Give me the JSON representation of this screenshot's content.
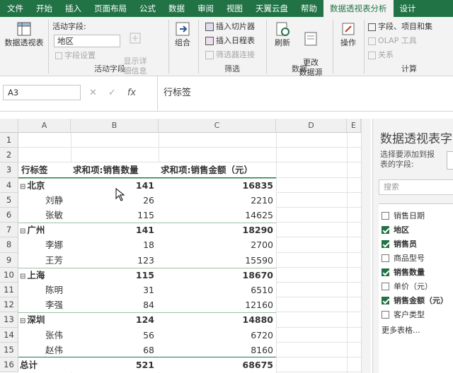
{
  "tabs": [
    "文件",
    "开始",
    "插入",
    "页面布局",
    "公式",
    "数据",
    "审阅",
    "视图",
    "天翼云盘",
    "帮助",
    "数据透视表分析",
    "设计"
  ],
  "active_tab_index": 10,
  "ribbon": {
    "pivot_button": "数据透视表",
    "active_field_label": "活动字段:",
    "active_field_value": "地区",
    "field_settings": "字段设置",
    "show_details": "显示详\n细信息",
    "active_field_group": "活动字段",
    "group_button": "组合",
    "insert_slicer": "插入切片器",
    "insert_timeline": "插入日程表",
    "filter_connections": "筛选器连接",
    "filter_group": "筛选",
    "refresh": "刷新",
    "change_source": "更改\n数据源",
    "data_group": "数据",
    "actions": "操作",
    "fields_items_sets": "字段、项目和集",
    "olap_tools": "OLAP 工具",
    "relationships": "关系",
    "calc_group": "计算"
  },
  "formula_bar": {
    "name_box": "A3",
    "cancel": "✕",
    "confirm": "✓",
    "fx": "fx",
    "value": "行标签"
  },
  "columns": [
    "A",
    "B",
    "C",
    "D",
    "E"
  ],
  "row_numbers": [
    "1",
    "2",
    "3",
    "4",
    "5",
    "6",
    "7",
    "8",
    "9",
    "10",
    "11",
    "12",
    "13",
    "14",
    "15",
    "16"
  ],
  "pivot": {
    "header_row_labels": "行标签",
    "header_qty": "求和项:销售数量",
    "header_amount": "求和项:销售金额（元）",
    "rows": [
      {
        "label": "北京",
        "qty": "141",
        "amount": "16835",
        "level": 0
      },
      {
        "label": "刘静",
        "qty": "26",
        "amount": "2210",
        "level": 1
      },
      {
        "label": "张敏",
        "qty": "115",
        "amount": "14625",
        "level": 1
      },
      {
        "label": "广州",
        "qty": "141",
        "amount": "18290",
        "level": 0
      },
      {
        "label": "李娜",
        "qty": "18",
        "amount": "2700",
        "level": 1
      },
      {
        "label": "王芳",
        "qty": "123",
        "amount": "15590",
        "level": 1
      },
      {
        "label": "上海",
        "qty": "115",
        "amount": "18670",
        "level": 0
      },
      {
        "label": "陈明",
        "qty": "31",
        "amount": "6510",
        "level": 1
      },
      {
        "label": "李强",
        "qty": "84",
        "amount": "12160",
        "level": 1
      },
      {
        "label": "深圳",
        "qty": "124",
        "amount": "14880",
        "level": 0
      },
      {
        "label": "张伟",
        "qty": "56",
        "amount": "6720",
        "level": 1
      },
      {
        "label": "赵伟",
        "qty": "68",
        "amount": "8160",
        "level": 1
      }
    ],
    "total": {
      "label": "总计",
      "qty": "521",
      "amount": "68675"
    },
    "collapse_symbol": "⊟"
  },
  "field_panel": {
    "title": "数据透视表字",
    "subtitle": "选择要添加到报表的字段:",
    "search_placeholder": "搜索",
    "fields": [
      {
        "name": "销售日期",
        "checked": false
      },
      {
        "name": "地区",
        "checked": true
      },
      {
        "name": "销售员",
        "checked": true
      },
      {
        "name": "商品型号",
        "checked": false
      },
      {
        "name": "销售数量",
        "checked": true
      },
      {
        "name": "单价（元）",
        "checked": false
      },
      {
        "name": "销售金额（元）",
        "checked": true
      },
      {
        "name": "客户类型",
        "checked": false
      }
    ],
    "more_tables": "更多表格..."
  },
  "colors": {
    "accent": "#217346",
    "header_border": "#217346"
  }
}
